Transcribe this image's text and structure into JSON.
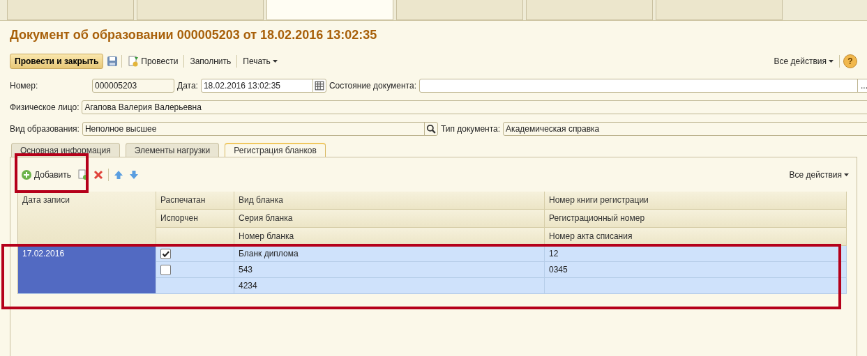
{
  "top_tabs": [
    {
      "selected": false
    },
    {
      "selected": false
    },
    {
      "selected": true
    },
    {
      "selected": false
    },
    {
      "selected": false
    },
    {
      "selected": false
    }
  ],
  "title": "Документ об образовании 000005203 от 18.02.2016 13:02:35",
  "toolbar": {
    "post_close": "Провести и закрыть",
    "post": "Провести",
    "fill": "Заполнить",
    "print": "Печать",
    "all_actions": "Все действия",
    "help": "?"
  },
  "fields": {
    "number_label": "Номер:",
    "number": "000005203",
    "date_label": "Дата:",
    "date": "18.02.2016 13:02:35",
    "state_label": "Состояние документа:",
    "state_button": "...",
    "person_label": "Физическое лицо:",
    "person": "Агапова Валерия Валерьевна",
    "edu_label": "Вид образования:",
    "edu": "Неполное высшее",
    "doc_type_label": "Тип документа:",
    "doc_type": "Академическая справка"
  },
  "tabs": [
    {
      "label": "Основная информация",
      "selected": false
    },
    {
      "label": "Элементы нагрузки",
      "selected": false
    },
    {
      "label": "Регистрация бланков",
      "selected": true
    }
  ],
  "table_toolbar": {
    "add": "Добавить",
    "all_actions": "Все действия"
  },
  "table": {
    "columns": [
      [
        "Дата записи"
      ],
      [
        "Распечатан",
        "Испорчен"
      ],
      [
        "Вид бланка",
        "Серия бланка",
        "Номер бланка"
      ],
      [
        "Номер книги регистрации",
        "Регистрационный номер",
        "Номер акта списания"
      ]
    ],
    "rows": [
      {
        "selected": true,
        "date": "17.02.2016",
        "printed": true,
        "spoiled": false,
        "form_type": "Бланк диплома",
        "series": "543",
        "number": "4234",
        "book_number": "12",
        "reg_number": "0345",
        "writeoff_act": ""
      }
    ]
  }
}
